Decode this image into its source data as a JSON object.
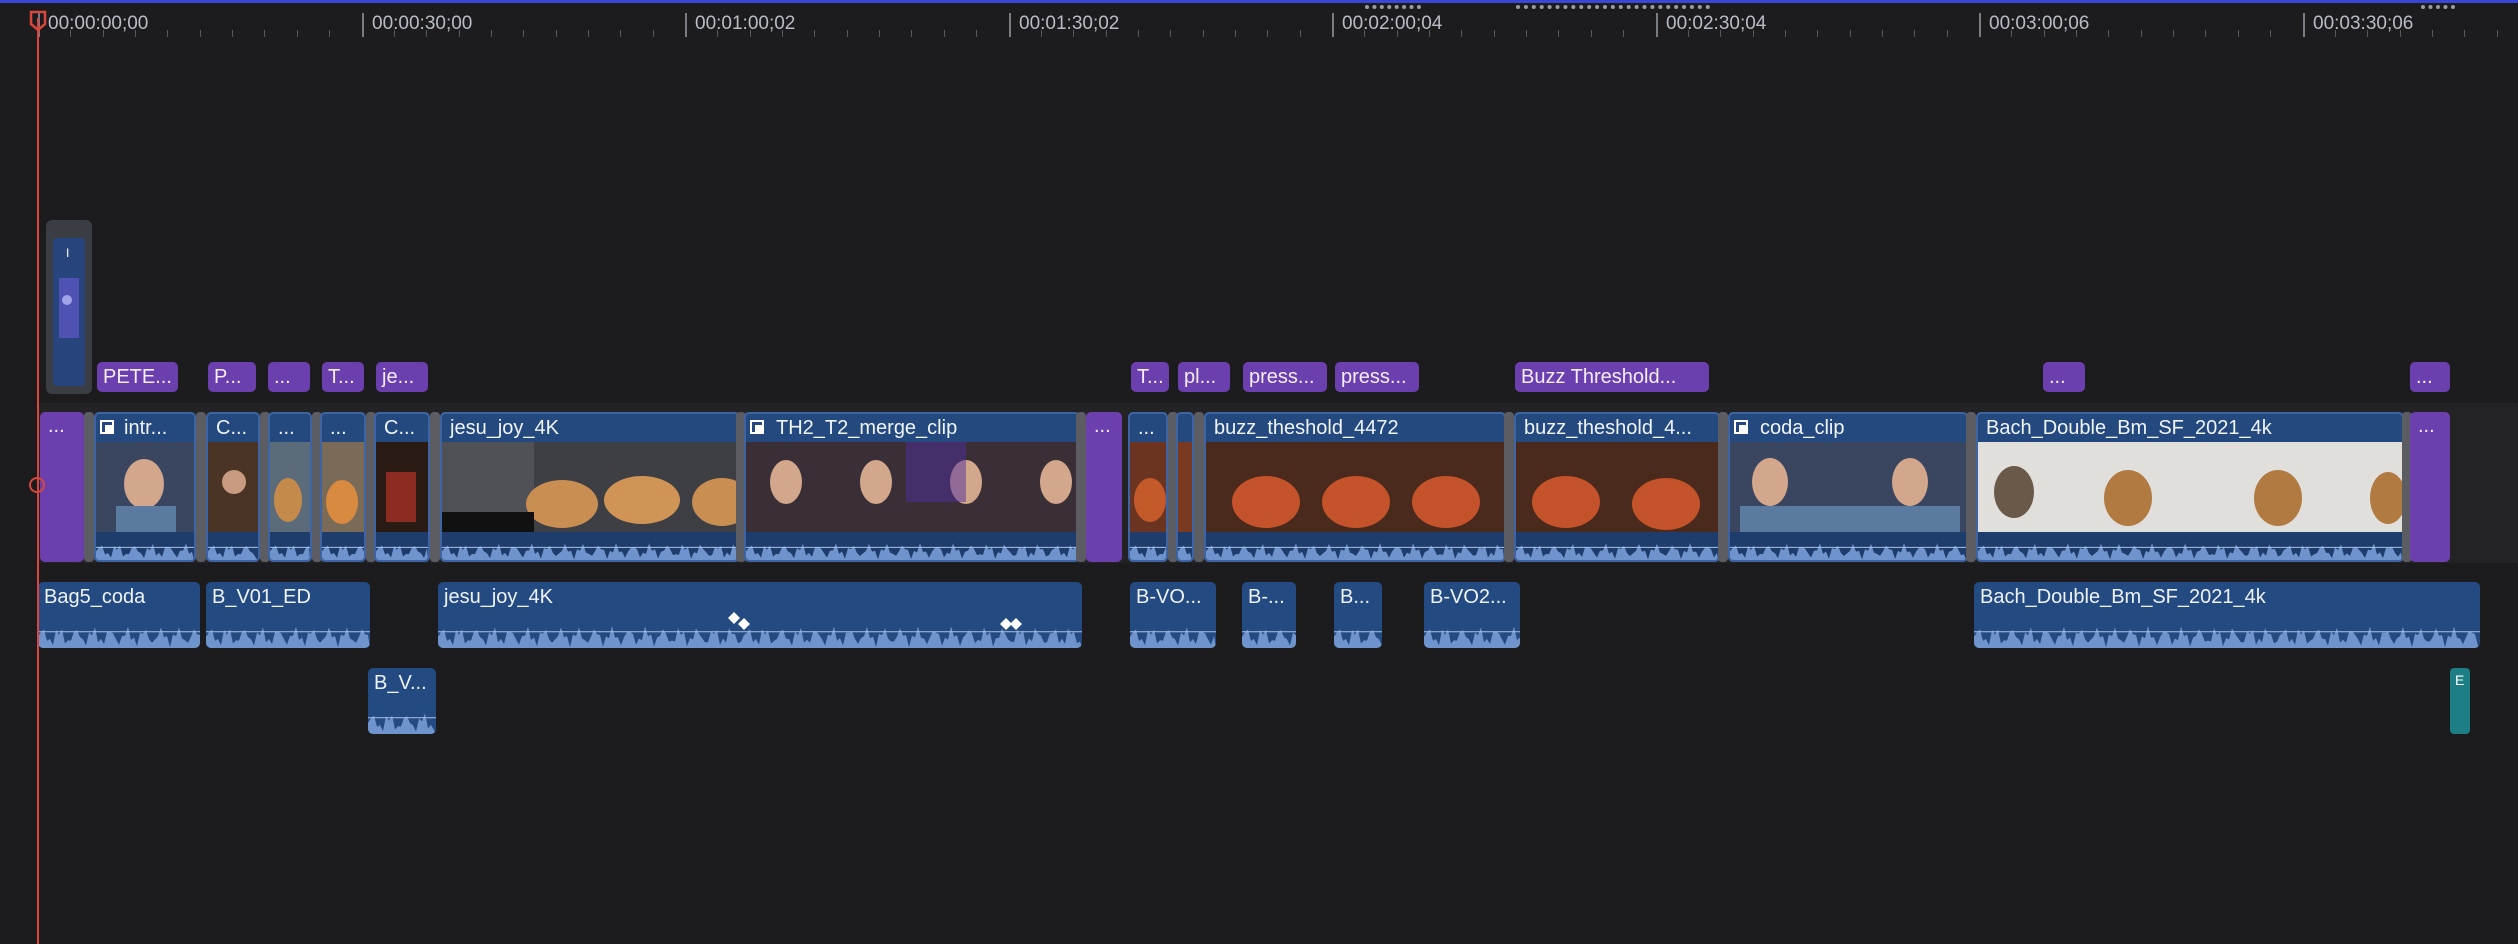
{
  "ruler": {
    "timecodes": [
      "00:00:00;00",
      "00:00:30;00",
      "00:01:00;02",
      "00:01:30;02",
      "00:02:00;04",
      "00:02:30;04",
      "00:03:00;06",
      "00:03:30;06"
    ]
  },
  "colors": {
    "background": "#1c1c1e",
    "playhead": "#d8463c",
    "title_clip": "#6c3fae",
    "video_clip": "#24497f",
    "audio_clip": "#244a82",
    "teal_clip": "#1d7e86"
  },
  "titles": [
    "PETE...",
    "P...",
    "...",
    "T...",
    "je...",
    "T...",
    "pl...",
    "press...",
    "press...",
    "Buzz Threshold...",
    "...",
    "..."
  ],
  "gaps": [
    "...",
    "...",
    "...",
    "..."
  ],
  "video_clips": [
    "intr...",
    "C...",
    "...",
    "...",
    "C...",
    "jesu_joy_4K",
    "TH2_T2_merge_clip",
    "...",
    "buzz_theshold_4472",
    "buzz_theshold_4...",
    "coda_clip",
    "Bach_Double_Bm_SF_2021_4k"
  ],
  "audio_clips": [
    "Bag5_coda",
    "B_V01_ED",
    "jesu_joy_4K",
    "B-VO...",
    "B-...",
    "B...",
    "B-VO2...",
    "Bach_Double_Bm_SF_2021_4k",
    "B_V..."
  ],
  "connected_still_label": "I",
  "teal_clip_label": "E"
}
